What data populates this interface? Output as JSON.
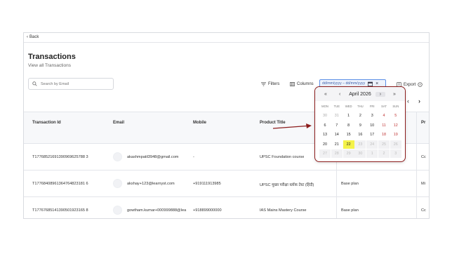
{
  "back_label": "Back",
  "header": {
    "title": "Transactions",
    "subtitle": "View all Transactions"
  },
  "search": {
    "placeholder": "Search by Email"
  },
  "toolbar": {
    "filters_label": "Filters",
    "columns_label": "Columns",
    "date_range_value": "dd/mm/yyyy – dd/mm/yyyy",
    "export_label": "Export"
  },
  "table": {
    "columns": [
      "Transaction Id",
      "Email",
      "Mobile",
      "Product Title",
      "",
      "Pr"
    ],
    "rows": [
      {
        "id": "T17768521691390969625788 3",
        "email": "akashmpatil3948@gmail.com",
        "mobile": "-",
        "product": "UPSC Foundation course",
        "plan": "",
        "pr": "Cc"
      },
      {
        "id": "T17768408961364764823181 6",
        "email": "akshay+123@learnyst.com",
        "mobile": "+919111913985",
        "product": "UPSC मुख्य परीक्षा ब्लॉक टेस्ट (हिंदी)",
        "plan": "Base plan",
        "pr": "Mi"
      },
      {
        "id": "T17767685141390501923165 8",
        "email": "gowtham.kumar+000999888@lea",
        "mobile": "+918899000000",
        "product": "IAS Mains Mastery Course",
        "plan": "Base plan",
        "pr": "Cc"
      }
    ]
  },
  "calendar": {
    "month_label": "April 2026",
    "nav": {
      "first": "«",
      "prev": "‹",
      "next": "›",
      "last": "»"
    },
    "weekdays": [
      "MON",
      "TUE",
      "WED",
      "THU",
      "FRI",
      "SAT",
      "SUN"
    ],
    "weeks": [
      [
        "30",
        "31",
        "1",
        "2",
        "3",
        "4",
        "5"
      ],
      [
        "6",
        "7",
        "8",
        "9",
        "10",
        "11",
        "12"
      ],
      [
        "13",
        "14",
        "15",
        "16",
        "17",
        "18",
        "19"
      ],
      [
        "20",
        "21",
        "22",
        "23",
        "24",
        "25",
        "26"
      ],
      [
        "27",
        "28",
        "29",
        "30",
        "1",
        "2",
        "3"
      ]
    ],
    "selected_day": "22"
  },
  "pager": {
    "prev": "‹",
    "next": "›"
  },
  "colors": {
    "accent": "#5b8ee6",
    "highlight_border": "#8c1c1c",
    "selected_day": "#f4f24a",
    "weekend": "#c03535"
  }
}
